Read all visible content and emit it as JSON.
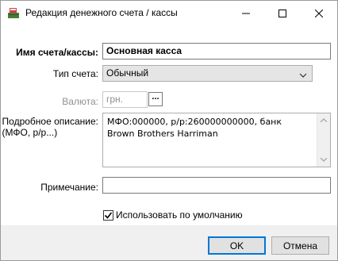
{
  "window": {
    "title": "Редакция денежного счета / кассы",
    "icon": "cash-register-icon",
    "controls": [
      "minimize-icon",
      "maximize-icon",
      "close-icon"
    ]
  },
  "form": {
    "account_name": {
      "label": "Имя счета/кассы:",
      "value": "Основная касса"
    },
    "account_type": {
      "label": "Тип счета:",
      "value": "Обычный"
    },
    "currency": {
      "label": "Валюта:",
      "value": "грн.",
      "browse_label": "...",
      "enabled": false
    },
    "description": {
      "label_line1": "Подробное описание:",
      "label_line2": "(МФО, р/р...)",
      "value": "МФО:000000, р/р:260000000000, банк Brown Brothers Harriman"
    },
    "note": {
      "label": "Примечание:",
      "value": ""
    },
    "default_checkbox": {
      "label": "Использовать по умолчанию",
      "checked": true
    }
  },
  "buttons": {
    "ok": "OK",
    "cancel": "Отмена"
  },
  "colors": {
    "accent": "#0078d7",
    "window_bg": "#f0f0f0",
    "client_bg": "#ffffff"
  }
}
